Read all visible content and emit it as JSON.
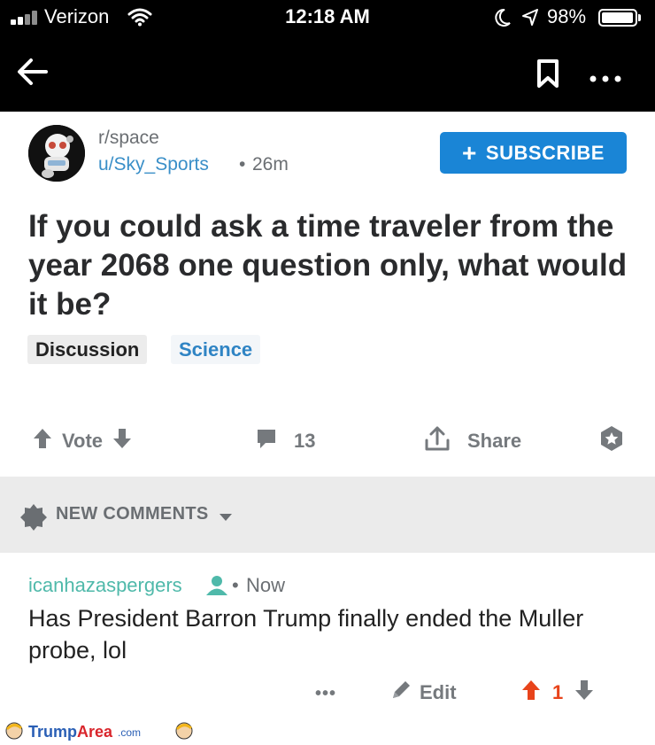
{
  "status_bar": {
    "carrier": "Verizon",
    "time": "12:18 AM",
    "battery": "98%",
    "battery_level": 0.98,
    "icons": [
      "signal-bars-icon",
      "wifi-icon",
      "moon-icon",
      "location-arrow-icon",
      "battery-icon"
    ]
  },
  "nav": {
    "icons": [
      "back-arrow-icon",
      "bookmark-icon",
      "more-dots-icon"
    ]
  },
  "post": {
    "subreddit": "r/space",
    "author": "u/Sky_Sports",
    "separator": "•",
    "age": "26m",
    "subscribe_label": "SUBSCRIBE",
    "subscribe_icon": "+",
    "title": "If you could ask a time traveler from the year 2068 one question only, what would it be?",
    "flairs": [
      "Discussion",
      "Science"
    ],
    "actions": {
      "vote_label": "Vote",
      "comments_count": "13",
      "share_label": "Share"
    }
  },
  "new_comments": {
    "label": "NEW COMMENTS"
  },
  "comment": {
    "author": "icanhazaspergers",
    "separator": "•",
    "age": "Now",
    "body": "Has President Barron Trump finally ended the Muller probe, lol",
    "more": "•••",
    "edit_label": "Edit",
    "score": "1"
  },
  "footer": {
    "brand_part1": "Trump",
    "brand_part2": "Area",
    "brand_tld": ".com"
  },
  "colors": {
    "accent_blue": "#1a85d6",
    "link_blue": "#3a8fc8",
    "user_teal": "#4fb9aa",
    "upvote_orange": "#e8441b"
  }
}
